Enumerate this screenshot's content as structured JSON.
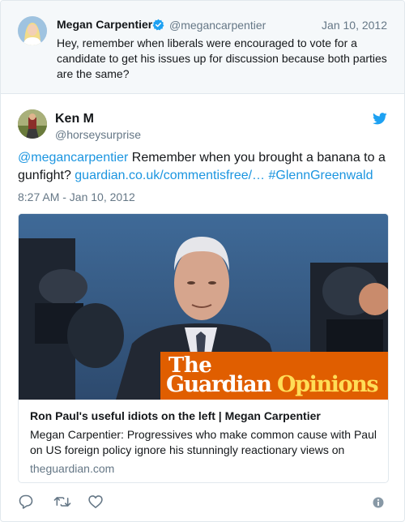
{
  "parent_tweet": {
    "author_name": "Megan Carpentier",
    "handle": "@megancarpentier",
    "date": "Jan 10, 2012",
    "text": "Hey, remember when liberals were encouraged to vote for a candidate to get his issues up for discussion because both parties are the same?"
  },
  "tweet": {
    "author_name": "Ken M",
    "handle": "@horseysurprise",
    "mention": "@megancarpentier",
    "text_part1": " Remember when you brought a banana to a gunfight? ",
    "link": "guardian.co.uk/commentisfree/…",
    "hashtag": "#GlennGreenwald",
    "timestamp": "8:27 AM - Jan 10, 2012"
  },
  "card": {
    "logo_the": "The",
    "logo_guardian": "Guardian",
    "logo_opinions": "Opinions",
    "title": "Ron Paul's useful idiots on the left | Megan Carpentier",
    "description": "Megan Carpentier: Progressives who make common cause with Paul on US foreign policy ignore his stunningly reactionary views on",
    "domain": "theguardian.com"
  },
  "icons": {
    "verified": "verified-badge-icon",
    "platform": "bird-icon",
    "reply": "reply-icon",
    "retweet": "retweet-icon",
    "like": "heart-icon",
    "info": "info-icon"
  },
  "colors": {
    "link": "#1b95e0",
    "muted": "#657786",
    "guardian_orange": "#e05e00",
    "guardian_yellow": "#ffdd57"
  }
}
